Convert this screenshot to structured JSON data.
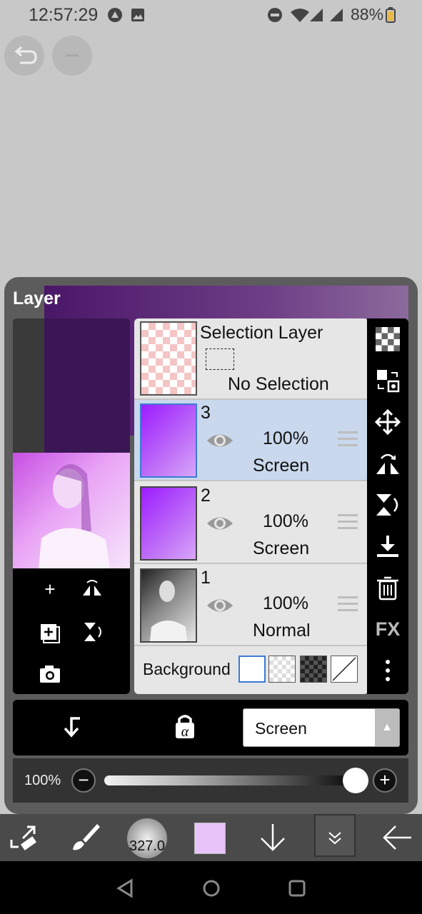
{
  "status": {
    "time": "12:57:29",
    "battery": "88%"
  },
  "panel": {
    "title": "Layer"
  },
  "selection_layer": {
    "title": "Selection Layer",
    "status": "No Selection"
  },
  "layers": [
    {
      "number": "3",
      "opacity": "100%",
      "blend": "Screen",
      "selected": true
    },
    {
      "number": "2",
      "opacity": "100%",
      "blend": "Screen",
      "selected": false
    },
    {
      "number": "1",
      "opacity": "100%",
      "blend": "Normal",
      "selected": false
    }
  ],
  "background": {
    "label": "Background"
  },
  "blend_mode": {
    "value": "Screen"
  },
  "opacity_slider": {
    "label": "100%",
    "value": 1.0
  },
  "brush": {
    "size": "327.0"
  },
  "right_toolbar": {
    "fx_label": "FX"
  },
  "colors": {
    "accent": "#3b7bd4",
    "selected_row": "#c9d8ec",
    "current_color": "#e7c3f9"
  }
}
